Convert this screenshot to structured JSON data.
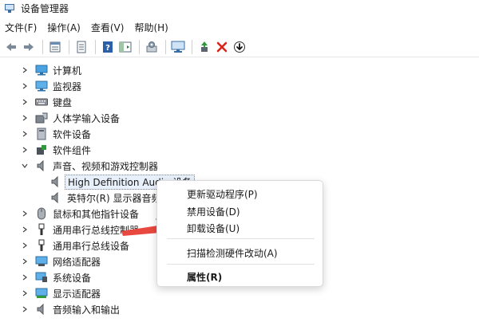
{
  "window": {
    "title": "设备管理器"
  },
  "menu": [
    "文件(F)",
    "操作(A)",
    "查看(V)",
    "帮助(H)"
  ],
  "toolbar": {
    "buttons": [
      {
        "name": "back-icon"
      },
      {
        "name": "forward-icon"
      },
      {
        "name": "properties-icon"
      },
      {
        "name": "view-icon"
      },
      {
        "name": "help-icon"
      },
      {
        "name": "toggle-pane-icon"
      },
      {
        "name": "update-driver-icon"
      },
      {
        "name": "scan-hardware-icon"
      },
      {
        "name": "enable-device-icon"
      },
      {
        "name": "uninstall-device-icon"
      },
      {
        "name": "download-icon"
      }
    ]
  },
  "tree": {
    "items": [
      {
        "label": "计算机",
        "icon": "computer-icon",
        "expanded": false
      },
      {
        "label": "监视器",
        "icon": "monitor-icon",
        "expanded": false
      },
      {
        "label": "键盘",
        "icon": "keyboard-icon",
        "expanded": false
      },
      {
        "label": "人体学输入设备",
        "icon": "hid-icon",
        "expanded": false
      },
      {
        "label": "软件设备",
        "icon": "software-device-icon",
        "expanded": false
      },
      {
        "label": "软件组件",
        "icon": "software-component-icon",
        "expanded": false
      },
      {
        "label": "声音、视频和游戏控制器",
        "icon": "speaker-icon",
        "expanded": true
      },
      {
        "label": "High Definition Audio 设备",
        "icon": "speaker-icon",
        "child": true,
        "selected": true
      },
      {
        "label": "英特尔(R) 显示器音频",
        "icon": "speaker-icon",
        "child": true
      },
      {
        "label": "鼠标和其他指针设备",
        "icon": "mouse-icon",
        "expanded": false
      },
      {
        "label": "通用串行总线控制器",
        "icon": "usb-icon",
        "expanded": false
      },
      {
        "label": "通用串行总线设备",
        "icon": "usb-icon",
        "expanded": false
      },
      {
        "label": "网络适配器",
        "icon": "network-icon",
        "expanded": false
      },
      {
        "label": "系统设备",
        "icon": "system-icon",
        "expanded": false
      },
      {
        "label": "显示适配器",
        "icon": "display-adapter-icon",
        "expanded": false
      },
      {
        "label": "音频输入和输出",
        "icon": "audio-io-icon",
        "expanded": false
      }
    ]
  },
  "context_menu": {
    "items": [
      {
        "label": "更新驱动程序(P)"
      },
      {
        "label": "禁用设备(D)"
      },
      {
        "label": "卸载设备(U)"
      },
      {
        "label": "扫描检测硬件改动(A)"
      },
      {
        "label": "属性(R)",
        "bold": true
      }
    ]
  },
  "colors": {
    "accent": "#3a6ea5",
    "arrow": "#e8483f",
    "uninstall_x": "#d9261c",
    "selection_border": "#4a90d9"
  }
}
